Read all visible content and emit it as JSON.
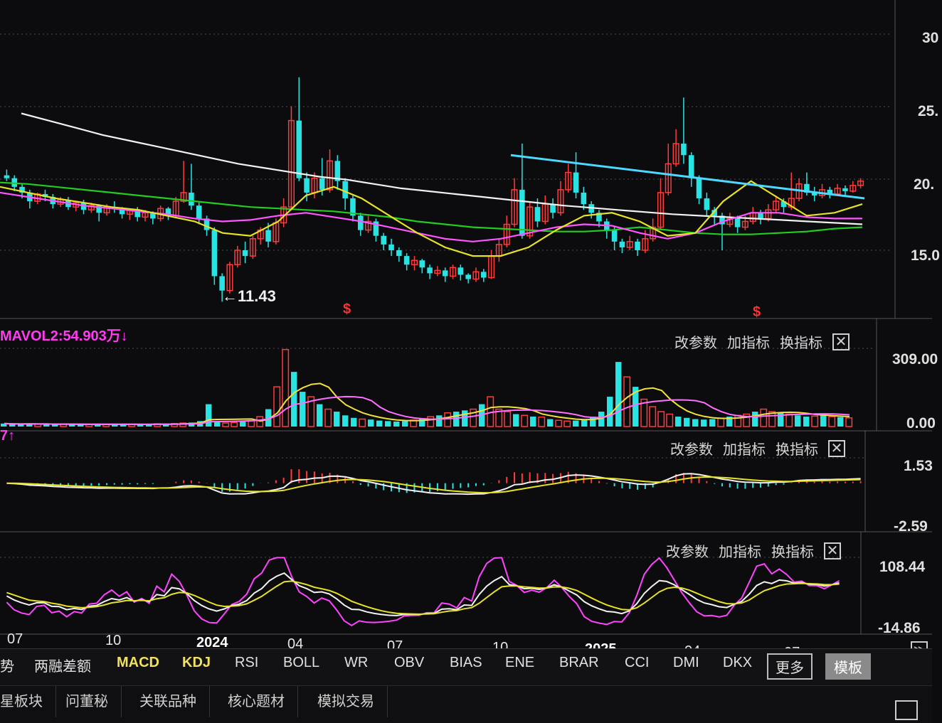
{
  "chart_data": [
    {
      "type": "candlestick",
      "panel": "price",
      "ylim": [
        11,
        30
      ],
      "y_ticks": [
        "30",
        "25.",
        "20.",
        "15.0"
      ],
      "low_annotation": "←11.43",
      "signals": [
        "$",
        "$"
      ],
      "candles": [
        [
          20.2,
          20.0,
          20.6,
          19.8
        ],
        [
          20.0,
          19.4,
          20.2,
          19.1
        ],
        [
          19.4,
          19.0,
          19.6,
          18.6
        ],
        [
          19.0,
          18.4,
          19.2,
          17.9
        ],
        [
          18.4,
          18.9,
          19.0,
          18.2
        ],
        [
          18.9,
          18.7,
          19.2,
          18.4
        ],
        [
          18.7,
          18.2,
          18.9,
          17.9
        ],
        [
          18.2,
          18.5,
          18.7,
          18.0
        ],
        [
          18.5,
          18.0,
          18.7,
          17.8
        ],
        [
          18.0,
          18.3,
          18.4,
          17.7
        ],
        [
          18.3,
          17.8,
          18.5,
          17.5
        ],
        [
          17.8,
          18.1,
          18.3,
          17.6
        ],
        [
          18.1,
          17.6,
          18.2,
          17.0
        ],
        [
          17.6,
          18.0,
          18.2,
          17.4
        ],
        [
          18.0,
          17.9,
          18.4,
          17.6
        ],
        [
          17.9,
          17.5,
          18.0,
          17.2
        ],
        [
          17.5,
          17.8,
          17.9,
          17.1
        ],
        [
          17.8,
          17.3,
          18.0,
          17.0
        ],
        [
          17.3,
          17.6,
          17.8,
          17.0
        ],
        [
          17.6,
          17.2,
          17.7,
          16.8
        ],
        [
          17.2,
          17.9,
          18.1,
          17.0
        ],
        [
          17.9,
          17.4,
          18.0,
          17.1
        ],
        [
          17.4,
          18.4,
          18.7,
          17.3
        ],
        [
          18.4,
          19.0,
          21.2,
          18.3
        ],
        [
          19.0,
          18.1,
          21.0,
          17.8
        ],
        [
          18.1,
          17.2,
          18.3,
          16.8
        ],
        [
          17.2,
          16.4,
          17.4,
          16.0
        ],
        [
          16.4,
          13.2,
          16.6,
          12.6
        ],
        [
          13.2,
          12.2,
          13.4,
          11.43
        ],
        [
          12.2,
          14.0,
          14.2,
          12.0
        ],
        [
          14.0,
          15.0,
          15.3,
          13.8
        ],
        [
          15.0,
          14.6,
          15.6,
          14.1
        ],
        [
          14.6,
          15.8,
          16.0,
          14.4
        ],
        [
          15.8,
          16.4,
          16.6,
          15.4
        ],
        [
          16.4,
          15.6,
          16.9,
          15.2
        ],
        [
          15.6,
          16.9,
          17.2,
          15.4
        ],
        [
          16.9,
          18.0,
          18.6,
          16.6
        ],
        [
          18.0,
          24.0,
          25.0,
          17.8
        ],
        [
          24.0,
          20.0,
          27.0,
          19.8
        ],
        [
          20.0,
          19.0,
          20.4,
          18.4
        ],
        [
          19.0,
          20.0,
          20.4,
          18.6
        ],
        [
          20.0,
          19.2,
          21.4,
          18.8
        ],
        [
          19.2,
          21.2,
          22.0,
          19.0
        ],
        [
          21.2,
          19.8,
          21.6,
          19.2
        ],
        [
          19.8,
          18.6,
          20.0,
          17.8
        ],
        [
          18.6,
          17.4,
          18.8,
          17.0
        ],
        [
          17.4,
          16.4,
          17.6,
          16.0
        ],
        [
          16.4,
          17.0,
          17.4,
          16.2
        ],
        [
          17.0,
          16.0,
          17.2,
          15.6
        ],
        [
          16.0,
          15.4,
          16.2,
          15.0
        ],
        [
          15.4,
          15.0,
          15.8,
          14.6
        ],
        [
          15.0,
          14.6,
          15.2,
          14.2
        ],
        [
          14.6,
          14.0,
          14.8,
          13.6
        ],
        [
          14.0,
          14.3,
          14.6,
          13.6
        ],
        [
          14.3,
          13.8,
          14.4,
          13.4
        ],
        [
          13.8,
          13.4,
          14.0,
          13.0
        ],
        [
          13.4,
          13.6,
          13.9,
          13.2
        ],
        [
          13.6,
          13.2,
          13.8,
          12.8
        ],
        [
          13.2,
          13.8,
          14.0,
          13.0
        ],
        [
          13.8,
          13.3,
          14.0,
          12.9
        ],
        [
          13.3,
          13.0,
          13.4,
          12.7
        ],
        [
          13.0,
          13.5,
          13.8,
          12.8
        ],
        [
          13.5,
          13.1,
          13.7,
          12.8
        ],
        [
          13.1,
          14.6,
          15.0,
          13.0
        ],
        [
          14.6,
          15.4,
          15.8,
          14.2
        ],
        [
          15.4,
          16.8,
          17.4,
          15.2
        ],
        [
          16.8,
          19.2,
          20.0,
          16.6
        ],
        [
          19.2,
          16.0,
          22.4,
          15.8
        ],
        [
          16.0,
          18.0,
          18.4,
          15.8
        ],
        [
          18.0,
          17.0,
          18.6,
          16.6
        ],
        [
          17.0,
          18.2,
          18.8,
          16.8
        ],
        [
          18.2,
          17.6,
          18.6,
          17.2
        ],
        [
          17.6,
          19.2,
          19.8,
          17.4
        ],
        [
          19.2,
          20.4,
          21.0,
          19.0
        ],
        [
          20.4,
          19.0,
          21.8,
          18.6
        ],
        [
          19.0,
          18.2,
          19.4,
          17.8
        ],
        [
          18.2,
          17.6,
          18.4,
          17.2
        ],
        [
          17.6,
          17.0,
          17.8,
          16.6
        ],
        [
          17.0,
          16.4,
          17.2,
          15.8
        ],
        [
          16.4,
          15.6,
          16.6,
          15.0
        ],
        [
          15.6,
          15.2,
          15.8,
          14.8
        ],
        [
          15.2,
          15.6,
          16.0,
          15.0
        ],
        [
          15.6,
          15.0,
          15.8,
          14.6
        ],
        [
          15.0,
          15.8,
          16.4,
          14.8
        ],
        [
          15.8,
          16.6,
          17.2,
          15.6
        ],
        [
          16.6,
          19.0,
          20.0,
          16.4
        ],
        [
          19.0,
          21.0,
          22.4,
          18.8
        ],
        [
          21.0,
          22.4,
          23.4,
          20.8
        ],
        [
          22.4,
          21.6,
          25.6,
          21.0
        ],
        [
          21.6,
          20.0,
          21.8,
          19.4
        ],
        [
          20.0,
          18.6,
          20.2,
          18.2
        ],
        [
          18.6,
          17.8,
          19.0,
          17.4
        ],
        [
          17.8,
          17.4,
          18.0,
          16.8
        ],
        [
          17.4,
          16.8,
          17.6,
          15.0
        ],
        [
          16.8,
          17.2,
          17.6,
          16.6
        ],
        [
          17.2,
          16.6,
          17.4,
          16.2
        ],
        [
          16.6,
          17.0,
          17.4,
          16.4
        ],
        [
          17.0,
          17.6,
          18.0,
          16.8
        ],
        [
          17.6,
          17.2,
          17.8,
          16.8
        ],
        [
          17.2,
          17.8,
          18.2,
          17.0
        ],
        [
          17.8,
          18.4,
          18.8,
          17.6
        ],
        [
          18.4,
          18.0,
          18.6,
          17.6
        ],
        [
          18.0,
          18.6,
          20.4,
          17.8
        ],
        [
          18.6,
          19.6,
          20.0,
          18.4
        ],
        [
          19.6,
          19.0,
          20.4,
          18.8
        ],
        [
          19.0,
          18.8,
          19.4,
          18.4
        ],
        [
          18.8,
          19.2,
          19.6,
          18.6
        ],
        [
          19.2,
          18.9,
          19.4,
          18.6
        ],
        [
          18.9,
          19.3,
          19.6,
          18.8
        ],
        [
          19.3,
          19.1,
          19.5,
          18.8
        ],
        [
          19.1,
          19.5,
          19.8,
          19.0
        ],
        [
          19.5,
          19.8,
          20.0,
          19.3
        ]
      ],
      "ma_lines": [
        {
          "color": "#f2f2f2",
          "values": [
            24.5,
            24.0,
            23.5,
            23.0,
            22.6,
            22.2,
            21.8,
            21.4,
            21.0,
            20.7,
            20.4,
            20.1,
            19.9,
            19.6,
            19.3,
            19.1,
            18.9,
            18.7,
            18.5,
            18.3,
            18.1,
            17.95,
            17.8,
            17.65,
            17.5,
            17.4,
            17.3,
            17.2,
            17.1,
            17.0,
            16.9,
            16.8
          ]
        },
        {
          "color": "#22cc22",
          "values": [
            19.7,
            19.6,
            19.4,
            19.2,
            19.0,
            18.8,
            18.6,
            18.4,
            18.2,
            18.0,
            17.9,
            17.8,
            17.7,
            17.5,
            17.3,
            17.0,
            16.8,
            16.6,
            16.5,
            16.4,
            16.3,
            16.3,
            16.4,
            16.6,
            16.4,
            16.2,
            16.1,
            16.1,
            16.2,
            16.3,
            16.5,
            16.6
          ]
        },
        {
          "color": "#ff55ff",
          "values": [
            19.0,
            18.7,
            18.4,
            18.1,
            17.9,
            17.7,
            17.5,
            17.2,
            17.0,
            17.1,
            17.4,
            17.6,
            17.3,
            17.0,
            16.6,
            16.2,
            15.8,
            15.6,
            15.8,
            16.2,
            16.6,
            16.8,
            16.7,
            16.2,
            15.8,
            16.2,
            17.0,
            17.6,
            17.6,
            17.3,
            17.2,
            17.2
          ]
        },
        {
          "color": "#e6e22a",
          "values": [
            19.4,
            19.0,
            18.6,
            18.3,
            18.0,
            17.8,
            17.4,
            17.0,
            16.2,
            16.0,
            17.0,
            18.8,
            19.4,
            18.6,
            17.4,
            16.2,
            15.2,
            14.6,
            14.6,
            15.2,
            16.4,
            17.4,
            17.6,
            17.0,
            16.0,
            16.2,
            18.4,
            19.8,
            18.6,
            17.4,
            17.6,
            18.2
          ]
        }
      ]
    },
    {
      "type": "bar",
      "panel": "volume",
      "label": "MAVOL2:54.903万↓",
      "y_ticks": [
        "309.00",
        "0.00"
      ],
      "ylim": [
        0,
        309
      ],
      "values": [
        12,
        10,
        9,
        11,
        10,
        9,
        8,
        10,
        9,
        8,
        9,
        10,
        8,
        9,
        10,
        9,
        8,
        9,
        11,
        10,
        12,
        14,
        16,
        22,
        90,
        18,
        14,
        16,
        20,
        24,
        40,
        70,
        160,
        310,
        220,
        140,
        120,
        90,
        70,
        60,
        45,
        35,
        30,
        28,
        24,
        22,
        20,
        22,
        26,
        34,
        40,
        45,
        55,
        60,
        65,
        70,
        90,
        120,
        70,
        60,
        50,
        45,
        40,
        38,
        30,
        25,
        22,
        24,
        30,
        40,
        60,
        120,
        260,
        200,
        160,
        110,
        80,
        60,
        50,
        40,
        35,
        30,
        28,
        30,
        34,
        40,
        45,
        50,
        60,
        70,
        60,
        55,
        50,
        45,
        40,
        42,
        45,
        40,
        38,
        35
      ]
    },
    {
      "type": "bar",
      "panel": "macd",
      "label": "7↑",
      "y_ticks": [
        "1.53",
        "-2.59"
      ],
      "ylim": [
        -2.59,
        1.53
      ]
    },
    {
      "type": "line",
      "panel": "kdj",
      "y_ticks": [
        "108.44",
        "-14.86"
      ],
      "ylim": [
        -14.86,
        108.44
      ]
    }
  ],
  "x_ticks": [
    {
      "label": "07",
      "bold": false
    },
    {
      "label": "10",
      "bold": false
    },
    {
      "label": "2024",
      "bold": true
    },
    {
      "label": "04",
      "bold": false
    },
    {
      "label": "07",
      "bold": false
    },
    {
      "label": "10",
      "bold": false
    },
    {
      "label": "2025",
      "bold": true
    },
    {
      "label": "04",
      "bold": false
    },
    {
      "label": "07",
      "bold": false
    }
  ],
  "panel_buttons": {
    "params": "改参数",
    "add": "加指标",
    "swap": "换指标",
    "close": "✕"
  },
  "indicator_bar": [
    "势",
    "两融差额",
    "MACD",
    "KDJ",
    "RSI",
    "BOLL",
    "WR",
    "OBV",
    "BIAS",
    "ENE",
    "BRAR",
    "CCI",
    "DMI",
    "DKX",
    "更多",
    "模板"
  ],
  "tabs": [
    "星板块",
    "问董秘",
    "关联品种",
    "核心题材",
    "模拟交易"
  ],
  "colors": {
    "up": "#ff3b3b",
    "down": "#29e3e3",
    "bg": "#0c0c0e",
    "grid": "#4a4a4a"
  }
}
